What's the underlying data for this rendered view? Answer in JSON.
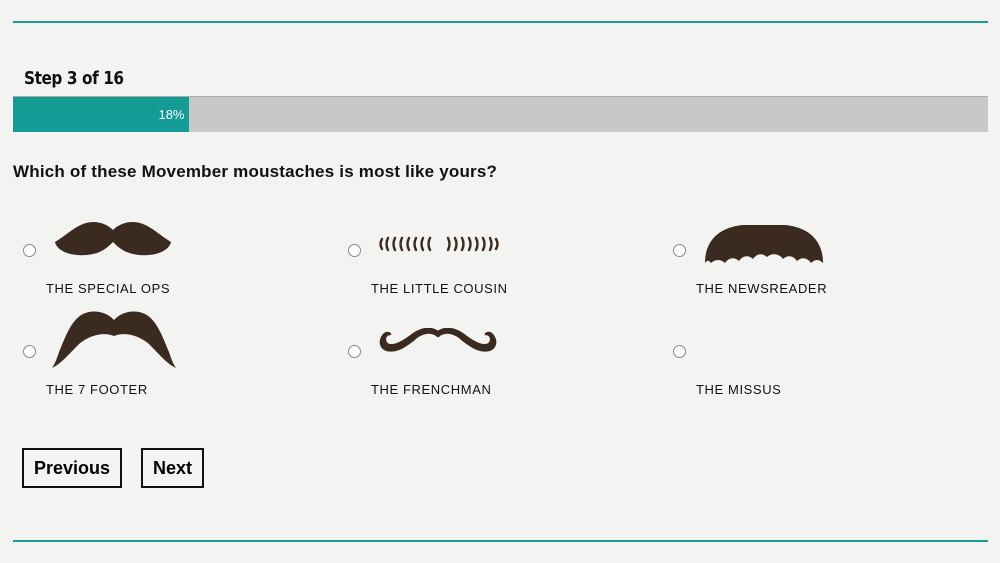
{
  "wizard": {
    "step_label": "Step 3 of 16",
    "progress_percent": 18,
    "progress_label": "18%"
  },
  "question": "Which of these Movember moustaches is most like yours?",
  "options": [
    {
      "label": "THE SPECIAL OPS",
      "icon": "special-ops-moustache-icon"
    },
    {
      "label": "THE LITTLE COUSIN",
      "icon": "little-cousin-moustache-icon"
    },
    {
      "label": "THE NEWSREADER",
      "icon": "newsreader-moustache-icon"
    },
    {
      "label": "THE 7 FOOTER",
      "icon": "seven-footer-moustache-icon"
    },
    {
      "label": "THE FRENCHMAN",
      "icon": "frenchman-moustache-icon"
    },
    {
      "label": "THE MISSUS",
      "icon": ""
    }
  ],
  "buttons": {
    "previous": "Previous",
    "next": "Next"
  },
  "colors": {
    "accent": "#139c96",
    "moustache": "#3a2a1f",
    "track": "#c8c8c9"
  }
}
